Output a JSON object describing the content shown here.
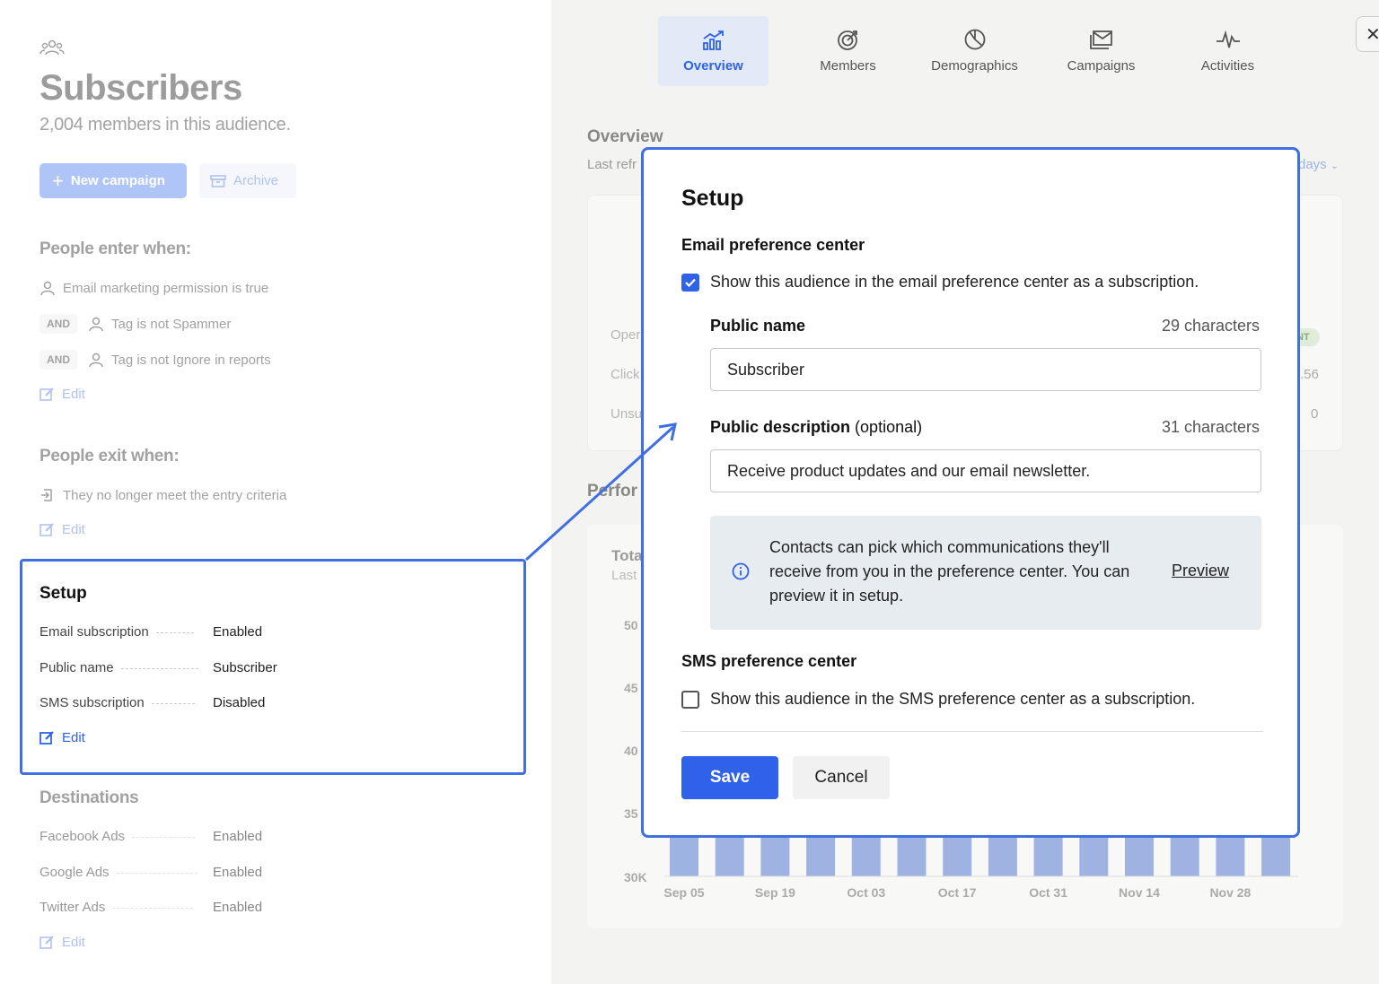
{
  "left_panel": {
    "title": "Subscribers",
    "subtitle": "2,004 members in this audience.",
    "new_campaign_label": "New campaign",
    "archive_label": "Archive",
    "enter_heading": "People enter when:",
    "enter_rules": [
      {
        "prefix": "",
        "text": "Email marketing permission is true"
      },
      {
        "prefix": "AND",
        "text": "Tag is not Spammer"
      },
      {
        "prefix": "AND",
        "text": "Tag is not Ignore in reports"
      }
    ],
    "exit_heading": "People exit when:",
    "exit_rule": "They no longer meet the entry criteria",
    "edit_label": "Edit",
    "setup": {
      "heading": "Setup",
      "rows": [
        {
          "key": "Email subscription",
          "value": "Enabled"
        },
        {
          "key": "Public name",
          "value": "Subscriber"
        },
        {
          "key": "SMS subscription",
          "value": "Disabled"
        }
      ]
    },
    "destinations": {
      "heading": "Destinations",
      "rows": [
        {
          "key": "Facebook Ads",
          "value": "Enabled"
        },
        {
          "key": "Google Ads",
          "value": "Enabled"
        },
        {
          "key": "Twitter Ads",
          "value": "Enabled"
        }
      ]
    }
  },
  "tabs": [
    {
      "label": "Overview",
      "icon": "chart-growth-icon",
      "active": true
    },
    {
      "label": "Members",
      "icon": "target-icon",
      "active": false
    },
    {
      "label": "Demographics",
      "icon": "pie-chart-icon",
      "active": false
    },
    {
      "label": "Campaigns",
      "icon": "envelope-stack-icon",
      "active": false
    },
    {
      "label": "Activities",
      "icon": "pulse-icon",
      "active": false
    }
  ],
  "background": {
    "overview_title": "Overview",
    "last_refreshed_partial": "Last refr",
    "range_partial": "days",
    "stat_labels_partial": [
      "Oper",
      "Click",
      "Unsu"
    ],
    "stat_values_partial": [
      ".56",
      "0"
    ],
    "pill_partial": "NT",
    "performance_partial": "Perfor",
    "total_partial": "Tota",
    "last_partial": "Last",
    "y_ticks_partial": [
      "50",
      "45",
      "40",
      "35",
      "30K"
    ],
    "x_ticks": [
      "Sep 05",
      "Sep 19",
      "Oct 03",
      "Oct 17",
      "Oct 31",
      "Nov 14",
      "Nov 28"
    ]
  },
  "modal": {
    "title": "Setup",
    "email_section": "Email preference center",
    "email_checkbox_label": "Show this audience in the email preference center as a subscription.",
    "email_checked": true,
    "public_name_label": "Public name",
    "public_name_count": "29 characters",
    "public_name_value": "Subscriber",
    "public_desc_label": "Public description",
    "public_desc_optional": "(optional)",
    "public_desc_count": "31 characters",
    "public_desc_value": "Receive product updates and our email newsletter.",
    "info_text": "Contacts can pick which communications they'll receive from you in the preference center. You can preview it in setup.",
    "info_link": "Preview",
    "sms_section": "SMS preference center",
    "sms_checkbox_label": "Show this audience in the SMS preference center as a subscription.",
    "sms_checked": false,
    "save_label": "Save",
    "cancel_label": "Cancel"
  },
  "colors": {
    "accent": "#2f62e8",
    "highlight_border": "#3f6fe0",
    "bar_color": "#9fb3e2"
  }
}
